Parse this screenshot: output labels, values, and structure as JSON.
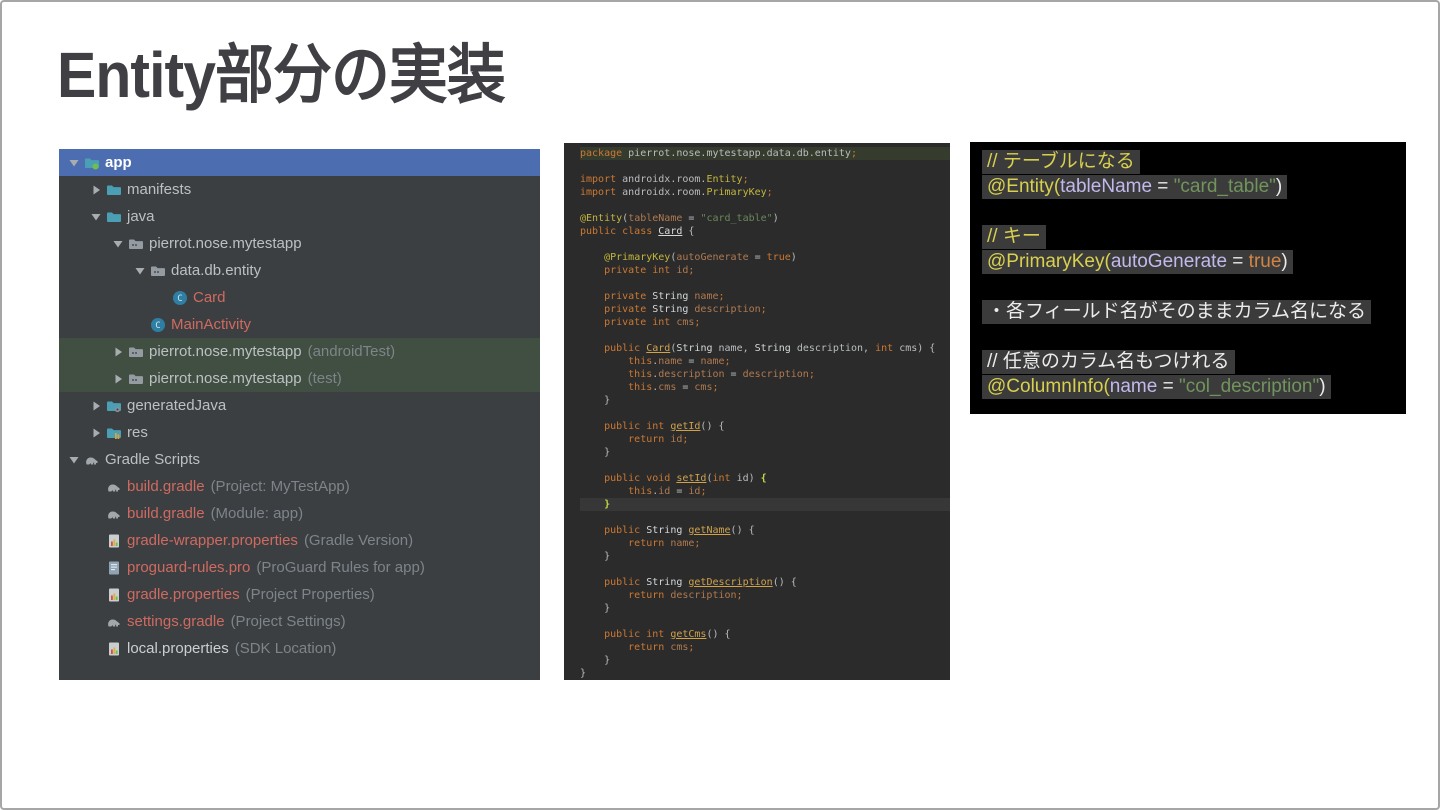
{
  "page": {
    "title": "Entity部分の実装"
  },
  "colors": {
    "selection_blue": "#4c6eb0",
    "test_row_green": "#404f42",
    "file_red": "#cf6a61",
    "annotation_yellow": "#c3b63f",
    "keyword_orange": "#cc7832",
    "string_green": "#6a8759",
    "notes_highlight": "#3b3b3b",
    "tree_background": "#3c3f41",
    "editor_background": "#2b2b2b",
    "notes_background": "#000000"
  },
  "project_tree": {
    "items": [
      {
        "level": 0,
        "arrow": "down",
        "icon": "app-module-icon",
        "label": "app",
        "row": "sel"
      },
      {
        "level": 1,
        "arrow": "right",
        "icon": "folder-icon",
        "label": "manifests"
      },
      {
        "level": 1,
        "arrow": "down",
        "icon": "folder-icon",
        "label": "java"
      },
      {
        "level": 2,
        "arrow": "down",
        "icon": "package-icon",
        "label": "pierrot.nose.mytestapp"
      },
      {
        "level": 3,
        "arrow": "down",
        "icon": "package-icon",
        "label": "data.db.entity"
      },
      {
        "level": 4,
        "arrow": "none",
        "icon": "class-icon",
        "label": "Card",
        "color": "red"
      },
      {
        "level": 3,
        "arrow": "none",
        "icon": "class-icon",
        "label": "MainActivity",
        "color": "red"
      },
      {
        "level": 2,
        "arrow": "right",
        "icon": "package-icon",
        "label": "pierrot.nose.mytestapp",
        "annotation": "(androidTest)",
        "row": "grn"
      },
      {
        "level": 2,
        "arrow": "right",
        "icon": "package-icon",
        "label": "pierrot.nose.mytestapp",
        "annotation": "(test)",
        "row": "grn"
      },
      {
        "level": 1,
        "arrow": "right",
        "icon": "generated-folder-icon",
        "label": "generatedJava"
      },
      {
        "level": 1,
        "arrow": "right",
        "icon": "res-folder-icon",
        "label": "res"
      },
      {
        "level": 0,
        "arrow": "down",
        "icon": "gradle-icon",
        "label": "Gradle Scripts"
      },
      {
        "level": 1,
        "arrow": "none",
        "icon": "gradle-icon",
        "label": "build.gradle",
        "color": "red",
        "annotation": "(Project: MyTestApp)"
      },
      {
        "level": 1,
        "arrow": "none",
        "icon": "gradle-icon",
        "label": "build.gradle",
        "color": "red",
        "annotation": "(Module: app)"
      },
      {
        "level": 1,
        "arrow": "none",
        "icon": "properties-icon",
        "label": "gradle-wrapper.properties",
        "color": "red",
        "annotation": "(Gradle Version)"
      },
      {
        "level": 1,
        "arrow": "none",
        "icon": "proguard-icon",
        "label": "proguard-rules.pro",
        "color": "red",
        "annotation": "(ProGuard Rules for app)"
      },
      {
        "level": 1,
        "arrow": "none",
        "icon": "properties-icon",
        "label": "gradle.properties",
        "color": "red",
        "annotation": "(Project Properties)"
      },
      {
        "level": 1,
        "arrow": "none",
        "icon": "gradle-icon",
        "label": "settings.gradle",
        "color": "red",
        "annotation": "(Project Settings)"
      },
      {
        "level": 1,
        "arrow": "none",
        "icon": "properties-icon",
        "label": "local.properties",
        "color": "white",
        "annotation": "(SDK Location)"
      }
    ]
  },
  "code_editor": {
    "lines": [
      {
        "hl": "pkg",
        "tokens": [
          [
            "package ",
            "kw"
          ],
          [
            "pierrot.nose.mytestapp.data.db.entity",
            "pl"
          ],
          [
            ";",
            "kw"
          ]
        ]
      },
      {
        "tokens": []
      },
      {
        "tokens": [
          [
            "import ",
            "kw"
          ],
          [
            "androidx.room.",
            "pl"
          ],
          [
            "Entity",
            "ann"
          ],
          [
            ";",
            "kw"
          ]
        ]
      },
      {
        "tokens": [
          [
            "import ",
            "kw"
          ],
          [
            "androidx.room.",
            "pl"
          ],
          [
            "PrimaryKey",
            "ann"
          ],
          [
            ";",
            "kw"
          ]
        ]
      },
      {
        "tokens": []
      },
      {
        "tokens": [
          [
            "@Entity",
            "ann"
          ],
          [
            "(",
            "pl"
          ],
          [
            "tableName",
            "fld"
          ],
          [
            " = ",
            "pl"
          ],
          [
            "\"card_table\"",
            "str"
          ],
          [
            ")",
            "pl"
          ]
        ]
      },
      {
        "tokens": [
          [
            "public class ",
            "kw"
          ],
          [
            "Card",
            "cls"
          ],
          [
            " {",
            "pl"
          ]
        ]
      },
      {
        "tokens": []
      },
      {
        "tokens": [
          [
            "    ",
            "pl"
          ],
          [
            "@PrimaryKey",
            "ann"
          ],
          [
            "(",
            "pl"
          ],
          [
            "autoGenerate",
            "fld"
          ],
          [
            " = ",
            "pl"
          ],
          [
            "true",
            "kw"
          ],
          [
            ")",
            "pl"
          ]
        ]
      },
      {
        "tokens": [
          [
            "    private int ",
            "kw"
          ],
          [
            "id",
            "fld"
          ],
          [
            ";",
            "kw"
          ]
        ]
      },
      {
        "tokens": []
      },
      {
        "tokens": [
          [
            "    private ",
            "kw"
          ],
          [
            "String ",
            "typ"
          ],
          [
            "name",
            "fld"
          ],
          [
            ";",
            "kw"
          ]
        ]
      },
      {
        "tokens": [
          [
            "    private ",
            "kw"
          ],
          [
            "String ",
            "typ"
          ],
          [
            "description",
            "fld"
          ],
          [
            ";",
            "kw"
          ]
        ]
      },
      {
        "tokens": [
          [
            "    private int ",
            "kw"
          ],
          [
            "cms",
            "fld"
          ],
          [
            ";",
            "kw"
          ]
        ]
      },
      {
        "tokens": []
      },
      {
        "tokens": [
          [
            "    public ",
            "kw"
          ],
          [
            "Card",
            "mth"
          ],
          [
            "(",
            "pl"
          ],
          [
            "String ",
            "typ"
          ],
          [
            "name",
            "pl"
          ],
          [
            ", ",
            "pl"
          ],
          [
            "String ",
            "typ"
          ],
          [
            "description",
            "pl"
          ],
          [
            ", ",
            "pl"
          ],
          [
            "int ",
            "kw"
          ],
          [
            "cms",
            "pl"
          ],
          [
            ") {",
            "pl"
          ]
        ]
      },
      {
        "tokens": [
          [
            "        this",
            "kw"
          ],
          [
            ".",
            "pl"
          ],
          [
            "name",
            "fld"
          ],
          [
            " = ",
            "pl"
          ],
          [
            "name",
            "fld"
          ],
          [
            ";",
            "kw"
          ]
        ]
      },
      {
        "tokens": [
          [
            "        this",
            "kw"
          ],
          [
            ".",
            "pl"
          ],
          [
            "description",
            "fld"
          ],
          [
            " = ",
            "pl"
          ],
          [
            "description",
            "fld"
          ],
          [
            ";",
            "kw"
          ]
        ]
      },
      {
        "tokens": [
          [
            "        this",
            "kw"
          ],
          [
            ".",
            "pl"
          ],
          [
            "cms",
            "fld"
          ],
          [
            " = ",
            "pl"
          ],
          [
            "cms",
            "fld"
          ],
          [
            ";",
            "kw"
          ]
        ]
      },
      {
        "tokens": [
          [
            "    }",
            "pl"
          ]
        ]
      },
      {
        "tokens": []
      },
      {
        "tokens": [
          [
            "    public int ",
            "kw"
          ],
          [
            "getId",
            "mth"
          ],
          [
            "() {",
            "pl"
          ]
        ]
      },
      {
        "tokens": [
          [
            "        return ",
            "kw"
          ],
          [
            "id",
            "fld"
          ],
          [
            ";",
            "kw"
          ]
        ]
      },
      {
        "tokens": [
          [
            "    }",
            "pl"
          ]
        ]
      },
      {
        "tokens": []
      },
      {
        "tokens": [
          [
            "    public void ",
            "kw"
          ],
          [
            "setId",
            "mth"
          ],
          [
            "(",
            "pl"
          ],
          [
            "int ",
            "kw"
          ],
          [
            "id",
            "pl"
          ],
          [
            ") ",
            "pl"
          ],
          [
            "{",
            "brc"
          ]
        ]
      },
      {
        "tokens": [
          [
            "        this",
            "kw"
          ],
          [
            ".",
            "pl"
          ],
          [
            "id",
            "fld"
          ],
          [
            " = ",
            "pl"
          ],
          [
            "id",
            "fld"
          ],
          [
            ";",
            "kw"
          ]
        ]
      },
      {
        "hl": "cur",
        "tokens": [
          [
            "    ",
            "pl"
          ],
          [
            "}",
            "brc"
          ]
        ]
      },
      {
        "tokens": []
      },
      {
        "tokens": [
          [
            "    public ",
            "kw"
          ],
          [
            "String ",
            "typ"
          ],
          [
            "getName",
            "mth"
          ],
          [
            "() {",
            "pl"
          ]
        ]
      },
      {
        "tokens": [
          [
            "        return ",
            "kw"
          ],
          [
            "name",
            "fld"
          ],
          [
            ";",
            "kw"
          ]
        ]
      },
      {
        "tokens": [
          [
            "    }",
            "pl"
          ]
        ]
      },
      {
        "tokens": []
      },
      {
        "tokens": [
          [
            "    public ",
            "kw"
          ],
          [
            "String ",
            "typ"
          ],
          [
            "getDescription",
            "mth"
          ],
          [
            "() {",
            "pl"
          ]
        ]
      },
      {
        "tokens": [
          [
            "        return ",
            "kw"
          ],
          [
            "description",
            "fld"
          ],
          [
            ";",
            "kw"
          ]
        ]
      },
      {
        "tokens": [
          [
            "    }",
            "pl"
          ]
        ]
      },
      {
        "tokens": []
      },
      {
        "tokens": [
          [
            "    public int ",
            "kw"
          ],
          [
            "getCms",
            "mth"
          ],
          [
            "() {",
            "pl"
          ]
        ]
      },
      {
        "tokens": [
          [
            "        return ",
            "kw"
          ],
          [
            "cms",
            "fld"
          ],
          [
            ";",
            "kw"
          ]
        ]
      },
      {
        "tokens": [
          [
            "    }",
            "pl"
          ]
        ]
      },
      {
        "tokens": [
          [
            "}",
            "pl"
          ]
        ]
      }
    ]
  },
  "notes_panel": {
    "lines": [
      {
        "tokens": [
          [
            "// テーブルになる",
            "ycm"
          ]
        ]
      },
      {
        "tokens": [
          [
            "@Entity",
            "yann"
          ],
          [
            "(",
            "yann"
          ],
          [
            "tableName",
            "attr"
          ],
          [
            " = ",
            "wht"
          ],
          [
            "\"card_table\"",
            "grn"
          ],
          [
            ")",
            "wht"
          ]
        ]
      },
      {
        "tokens": []
      },
      {
        "tokens": [
          [
            "// キー",
            "ycm"
          ]
        ]
      },
      {
        "tokens": [
          [
            "@PrimaryKey",
            "yann"
          ],
          [
            "(",
            "yann"
          ],
          [
            "autoGenerate",
            "attr"
          ],
          [
            " = ",
            "wht"
          ],
          [
            "true",
            "org"
          ],
          [
            ")",
            "wht"
          ]
        ]
      },
      {
        "tokens": []
      },
      {
        "tokens": [
          [
            "・各フィールド名がそのままカラム名になる",
            "wht"
          ]
        ]
      },
      {
        "tokens": []
      },
      {
        "tokens": [
          [
            "// 任意のカラム名もつけれる",
            "wht"
          ]
        ]
      },
      {
        "tokens": [
          [
            "@ColumnInfo",
            "yann"
          ],
          [
            "(",
            "yann"
          ],
          [
            "name",
            "attr"
          ],
          [
            " = ",
            "wht"
          ],
          [
            "\"col_description\"",
            "grn"
          ],
          [
            ")",
            "wht"
          ]
        ]
      }
    ]
  }
}
